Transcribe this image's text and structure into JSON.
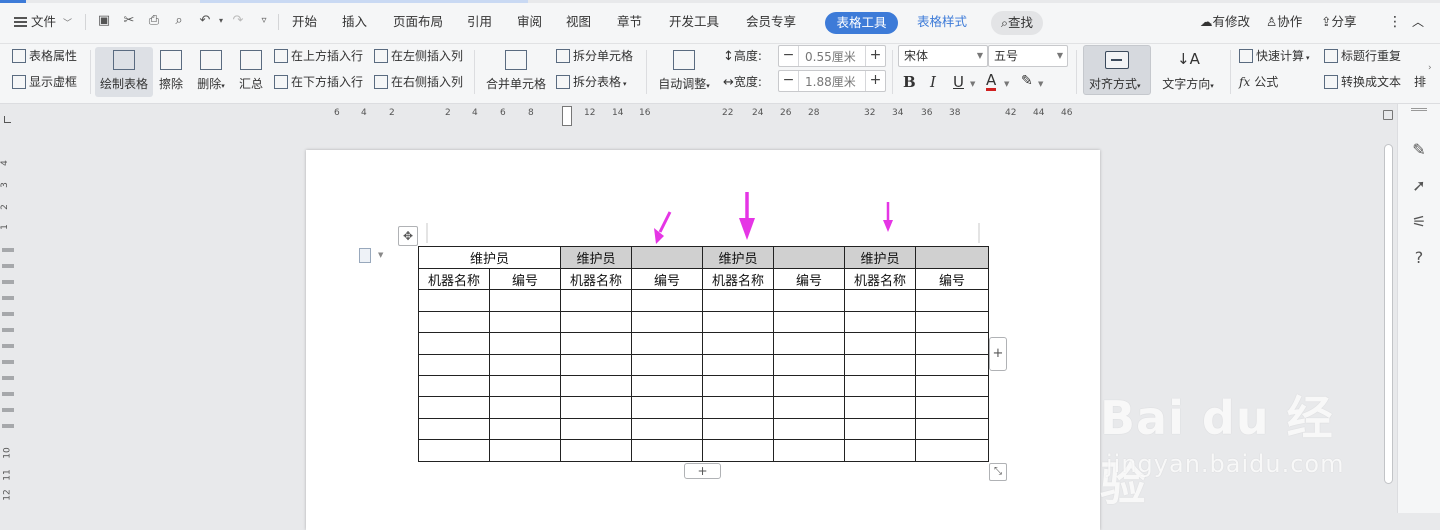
{
  "menu": {
    "file_label": "文件",
    "tabs": [
      "开始",
      "插入",
      "页面布局",
      "引用",
      "审阅",
      "视图",
      "章节",
      "开发工具",
      "会员专享"
    ],
    "active_tab": "表格工具",
    "tab_table_style": "表格样式",
    "search_label": "查找",
    "right": {
      "modified": "有修改",
      "collaborate": "协作",
      "share": "分享"
    }
  },
  "ribbon": {
    "table_props": "表格属性",
    "show_gridlines": "显示虚框",
    "draw_table": "绘制表格",
    "erase": "擦除",
    "delete": "删除",
    "summary": "汇总",
    "insert_row_above": "在上方插入行",
    "insert_row_below": "在下方插入行",
    "insert_col_left": "在左侧插入列",
    "insert_col_right": "在右侧插入列",
    "merge_cells": "合并单元格",
    "split_cells": "拆分单元格",
    "split_table": "拆分表格",
    "auto_fit": "自动调整",
    "height_label": "高度:",
    "height_value": "0.55厘米",
    "width_label": "宽度:",
    "width_value": "1.88厘米",
    "font_name": "宋体",
    "font_size": "五号",
    "align": "对齐方式",
    "text_direction": "文字方向",
    "quick_calc": "快速计算",
    "formula": "公式",
    "repeat_header": "标题行重复",
    "convert_to_text": "转换成文本",
    "more": "排"
  },
  "ruler": {
    "h_ticks": [
      "6",
      "4",
      "2",
      "2",
      "4",
      "6",
      "8",
      "12",
      "14",
      "16",
      "22",
      "24",
      "26",
      "28",
      "32",
      "34",
      "36",
      "38",
      "42",
      "44",
      "46"
    ],
    "v_ticks": [
      "4",
      "3",
      "2",
      "1",
      "10",
      "11",
      "12"
    ]
  },
  "table": {
    "header_row": [
      "维护员",
      "维护员",
      "",
      "维护员",
      "",
      "维护员",
      ""
    ],
    "sub_header": [
      "机器名称",
      "编号",
      "机器名称",
      "编号",
      "机器名称",
      "编号",
      "机器名称",
      "编号"
    ],
    "empty_rows": 8,
    "gray_color": "#d0d0d0"
  },
  "watermark": {
    "brand": "Bai du 经验",
    "url": "jingyan.baidu.com"
  },
  "colors": {
    "accent": "#3d7bd8",
    "arrow": "#e535e5"
  }
}
